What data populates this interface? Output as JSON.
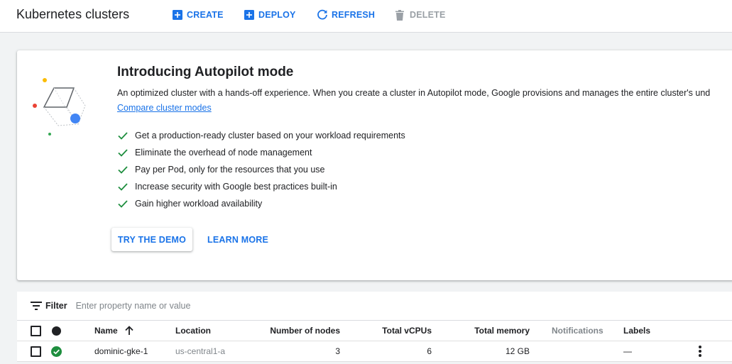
{
  "header": {
    "title": "Kubernetes clusters",
    "create": "CREATE",
    "deploy": "DEPLOY",
    "refresh": "REFRESH",
    "delete": "DELETE"
  },
  "promo": {
    "title": "Introducing Autopilot mode",
    "description": "An optimized cluster with a hands-off experience. When you create a cluster in Autopilot mode, Google provisions and manages the entire cluster's und",
    "link": "Compare cluster modes",
    "benefits": [
      "Get a production-ready cluster based on your workload requirements",
      "Eliminate the overhead of node management",
      "Pay per Pod, only for the resources that you use",
      "Increase security with Google best practices built-in",
      "Gain higher workload availability"
    ],
    "try_demo": "TRY THE DEMO",
    "learn_more": "LEARN MORE"
  },
  "filter": {
    "label": "Filter",
    "placeholder": "Enter property name or value"
  },
  "table": {
    "columns": {
      "name": "Name",
      "location": "Location",
      "nodes": "Number of nodes",
      "vcpus": "Total vCPUs",
      "memory": "Total memory",
      "notifications": "Notifications",
      "labels": "Labels"
    },
    "sort_icon": "arrow-up-icon",
    "rows": [
      {
        "status_icon": "check-circle-icon",
        "name": "dominic-gke-1",
        "location": "us-central1-a",
        "nodes": "3",
        "vcpus": "6",
        "memory": "12 GB",
        "notifications": "",
        "labels": "—"
      }
    ]
  },
  "colors": {
    "accent": "#1a73e8",
    "success": "#1e8e3e",
    "disabled": "#9aa0a6"
  }
}
